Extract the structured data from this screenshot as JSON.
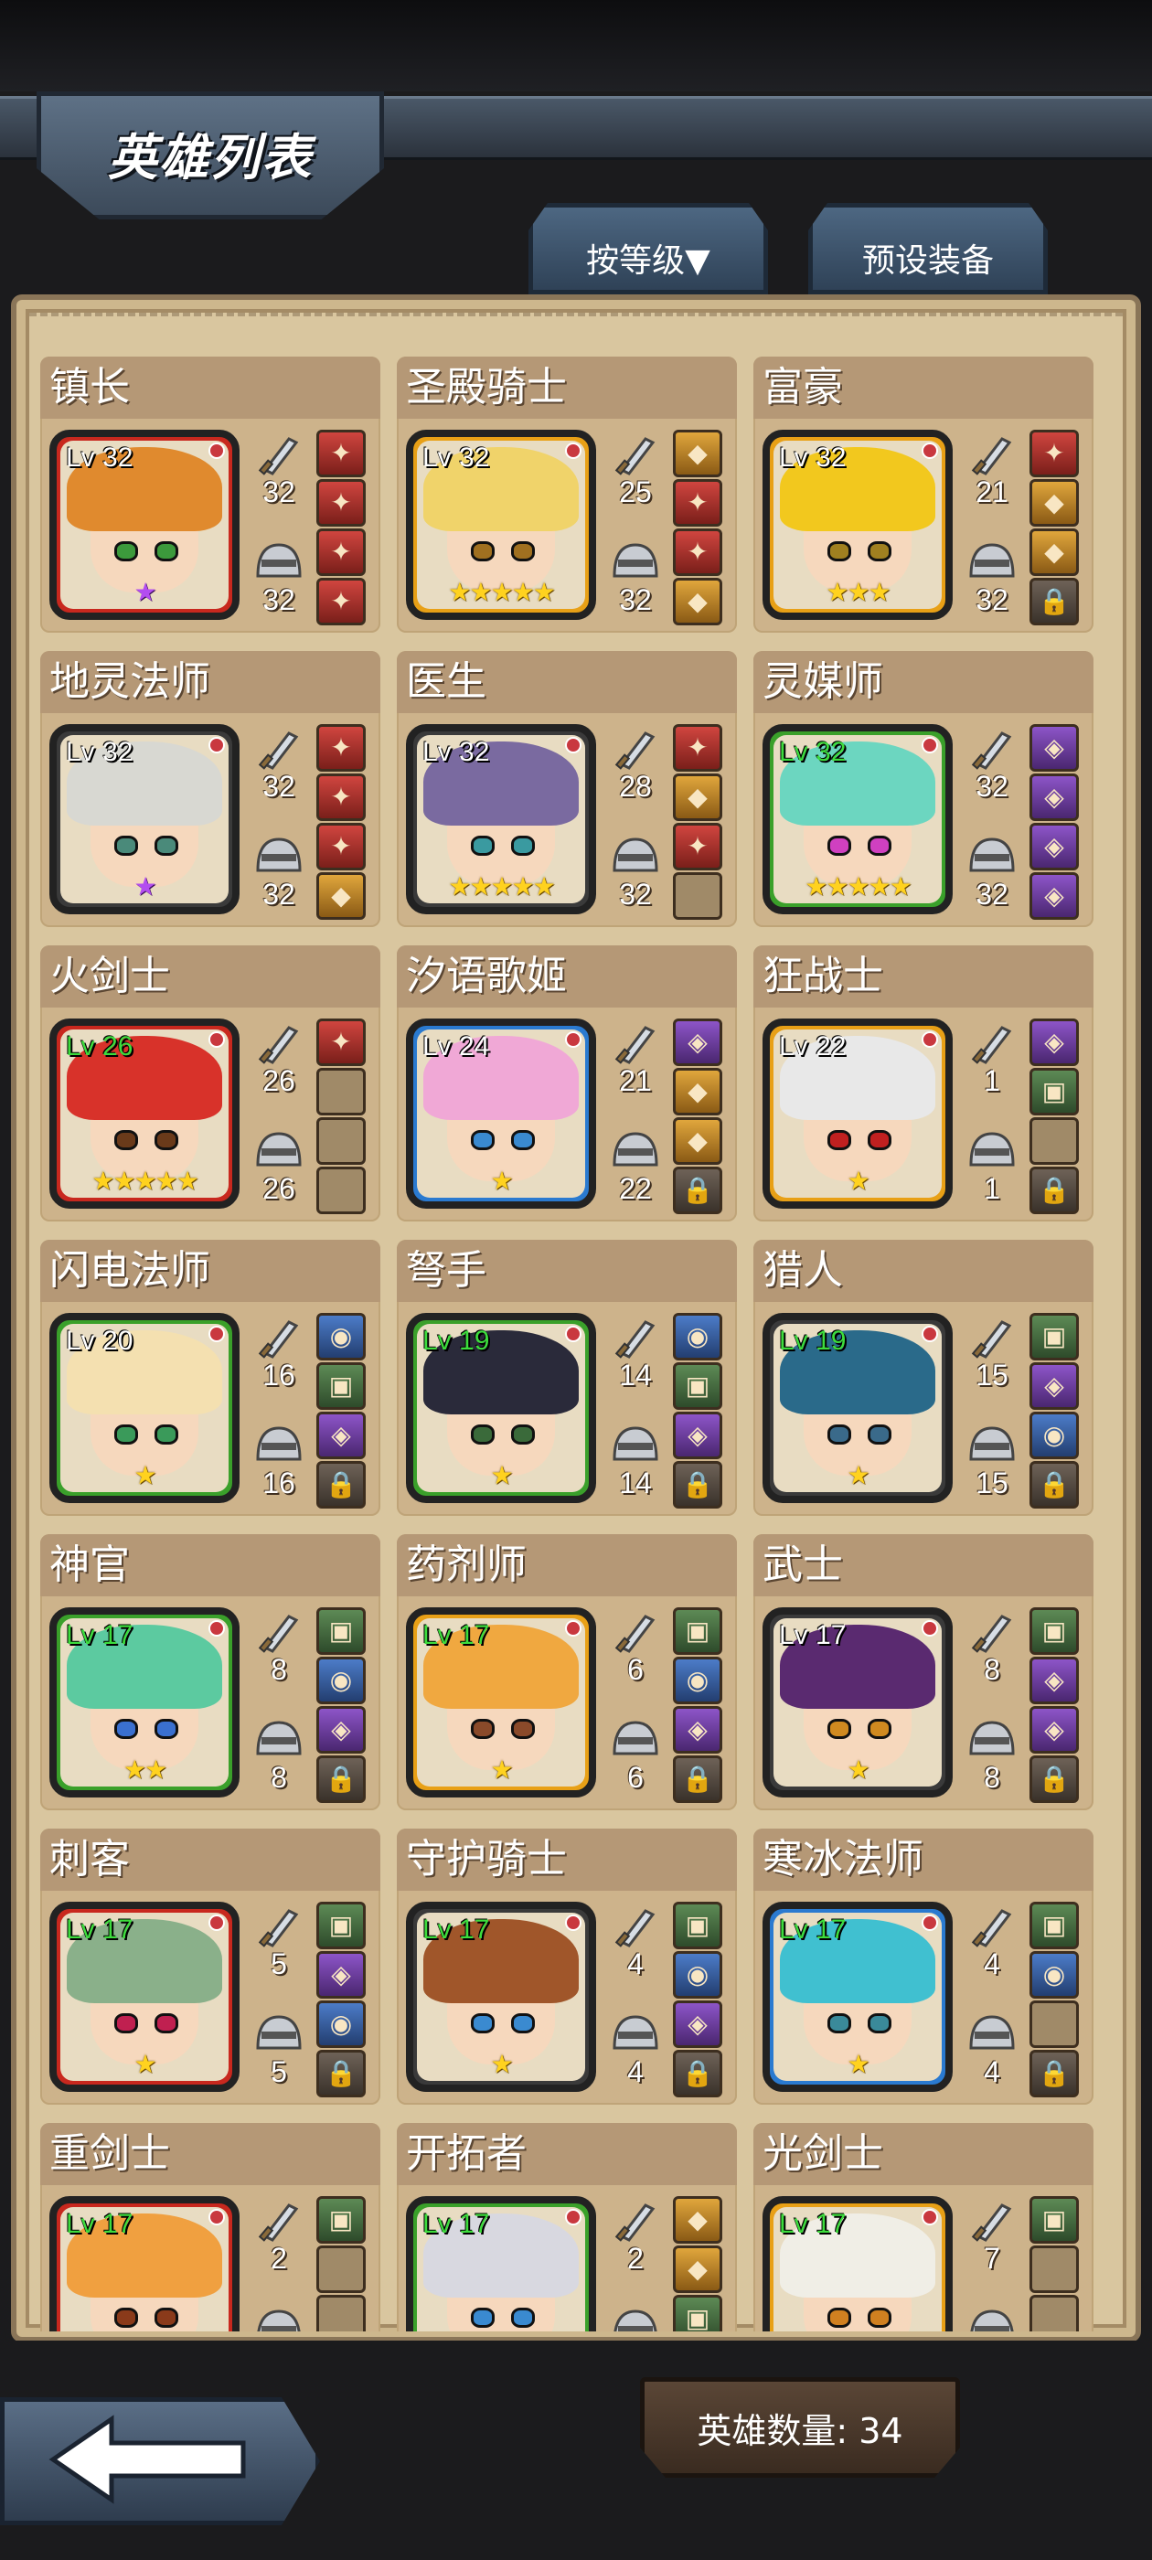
{
  "header": {
    "title": "英雄列表"
  },
  "tabs": {
    "sort_label": "按等级▼",
    "preset_label": "预设装备"
  },
  "footer": {
    "hero_count": "英雄数量: 34"
  },
  "heroes": [
    {
      "name": "镇长",
      "level": "Lv 32",
      "level_color": "#ffffff",
      "frame": "red",
      "hair": "#e08a2e",
      "eye": "#3c9a3c",
      "stars": "★",
      "star_color": "purple",
      "atk": "32",
      "def": "32",
      "slots": [
        "red",
        "red",
        "red",
        "red"
      ]
    },
    {
      "name": "圣殿骑士",
      "level": "Lv 32",
      "level_color": "#ffffff",
      "frame": "orange",
      "hair": "#f0d36a",
      "eye": "#a07020",
      "stars": "★★★★★",
      "star_color": "gold",
      "atk": "25",
      "def": "32",
      "slots": [
        "orange",
        "red",
        "red",
        "orange"
      ]
    },
    {
      "name": "富豪",
      "level": "Lv 32",
      "level_color": "#ffffff",
      "frame": "orange",
      "hair": "#f2c81e",
      "eye": "#a08020",
      "stars": "★★★",
      "star_color": "gold",
      "atk": "21",
      "def": "32",
      "slots": [
        "red",
        "orange",
        "orange",
        "lock"
      ]
    },
    {
      "name": "地灵法师",
      "level": "Lv 32",
      "level_color": "#ffffff",
      "frame": "dark",
      "hair": "#d8d8d2",
      "eye": "#4a8a7a",
      "stars": "★",
      "star_color": "purple",
      "atk": "32",
      "def": "32",
      "slots": [
        "red",
        "red",
        "red",
        "orange"
      ]
    },
    {
      "name": "医生",
      "level": "Lv 32",
      "level_color": "#ffffff",
      "frame": "dark",
      "hair": "#7a6aa0",
      "eye": "#3a9aa0",
      "stars": "★★★★★",
      "star_color": "gold",
      "atk": "28",
      "def": "32",
      "slots": [
        "red",
        "orange",
        "red",
        "empty"
      ]
    },
    {
      "name": "灵媒师",
      "level": "Lv 32",
      "level_color": "#3ddc3d",
      "frame": "green",
      "hair": "#6cd6c0",
      "eye": "#d040c0",
      "stars": "★★★★★",
      "star_color": "gold",
      "atk": "32",
      "def": "32",
      "slots": [
        "purple",
        "purple",
        "purple",
        "purple"
      ]
    },
    {
      "name": "火剑士",
      "level": "Lv 26",
      "level_color": "#3ddc3d",
      "frame": "red",
      "hair": "#d8322a",
      "eye": "#6a3a1a",
      "stars": "★★★★★",
      "star_color": "gold",
      "atk": "26",
      "def": "26",
      "slots": [
        "red",
        "empty",
        "empty",
        "empty"
      ]
    },
    {
      "name": "汐语歌姬",
      "level": "Lv 24",
      "level_color": "#ffffff",
      "frame": "blue",
      "hair": "#f0a8d6",
      "eye": "#3a8ad0",
      "stars": "★",
      "star_color": "gold",
      "atk": "21",
      "def": "22",
      "slots": [
        "purple",
        "orange",
        "orange",
        "lock"
      ]
    },
    {
      "name": "狂战士",
      "level": "Lv 22",
      "level_color": "#ffffff",
      "frame": "orange",
      "hair": "#e8e8e8",
      "eye": "#c02020",
      "stars": "★",
      "star_color": "gold",
      "atk": "1",
      "def": "1",
      "slots": [
        "purple",
        "green",
        "empty",
        "lock"
      ]
    },
    {
      "name": "闪电法师",
      "level": "Lv 20",
      "level_color": "#ffffff",
      "frame": "green",
      "hair": "#f4e0b0",
      "eye": "#3a9a5a",
      "stars": "★",
      "star_color": "gold",
      "atk": "16",
      "def": "16",
      "slots": [
        "blue",
        "green",
        "purple",
        "lock"
      ]
    },
    {
      "name": "弩手",
      "level": "Lv 19",
      "level_color": "#3ddc3d",
      "frame": "green",
      "hair": "#2a2a3a",
      "eye": "#3a6a3a",
      "stars": "★",
      "star_color": "gold",
      "atk": "14",
      "def": "14",
      "slots": [
        "blue",
        "green",
        "purple",
        "lock"
      ]
    },
    {
      "name": "猎人",
      "level": "Lv 19",
      "level_color": "#3ddc3d",
      "frame": "dark",
      "hair": "#2a6a8a",
      "eye": "#3a6a8a",
      "stars": "★",
      "star_color": "gold",
      "atk": "15",
      "def": "15",
      "slots": [
        "green",
        "purple",
        "blue",
        "lock"
      ]
    },
    {
      "name": "神官",
      "level": "Lv 17",
      "level_color": "#3ddc3d",
      "frame": "green",
      "hair": "#5ccaa0",
      "eye": "#3a70d0",
      "stars": "★★",
      "star_color": "gold",
      "atk": "8",
      "def": "8",
      "slots": [
        "green",
        "blue",
        "purple",
        "lock"
      ]
    },
    {
      "name": "药剂师",
      "level": "Lv 17",
      "level_color": "#3ddc3d",
      "frame": "orange",
      "hair": "#f0a840",
      "eye": "#8a4a2a",
      "stars": "★",
      "star_color": "gold",
      "atk": "6",
      "def": "6",
      "slots": [
        "green",
        "blue",
        "purple",
        "lock"
      ]
    },
    {
      "name": "武士",
      "level": "Lv 17",
      "level_color": "#ffffff",
      "frame": "dark",
      "hair": "#5a2a70",
      "eye": "#d08a20",
      "stars": "★",
      "star_color": "gold",
      "atk": "8",
      "def": "8",
      "slots": [
        "green",
        "purple",
        "purple",
        "lock"
      ]
    },
    {
      "name": "刺客",
      "level": "Lv 17",
      "level_color": "#3ddc3d",
      "frame": "red",
      "hair": "#8ab08a",
      "eye": "#c02050",
      "stars": "★",
      "star_color": "gold",
      "atk": "5",
      "def": "5",
      "slots": [
        "green",
        "purple",
        "blue",
        "lock"
      ]
    },
    {
      "name": "守护骑士",
      "level": "Lv 17",
      "level_color": "#3ddc3d",
      "frame": "dark",
      "hair": "#a0562a",
      "eye": "#3a8ad0",
      "stars": "★",
      "star_color": "gold",
      "atk": "4",
      "def": "4",
      "slots": [
        "green",
        "blue",
        "purple",
        "lock"
      ]
    },
    {
      "name": "寒冰法师",
      "level": "Lv 17",
      "level_color": "#3ddc3d",
      "frame": "blue",
      "hair": "#40c0d0",
      "eye": "#3a8a9a",
      "stars": "★",
      "star_color": "gold",
      "atk": "4",
      "def": "4",
      "slots": [
        "green",
        "blue",
        "empty",
        "lock"
      ]
    },
    {
      "name": "重剑士",
      "level": "Lv 17",
      "level_color": "#3ddc3d",
      "frame": "red",
      "hair": "#f0a040",
      "eye": "#8a3a1a",
      "stars": "",
      "star_color": "gold",
      "atk": "2",
      "def": "",
      "slots": [
        "green",
        "empty",
        "empty",
        "empty"
      ]
    },
    {
      "name": "开拓者",
      "level": "Lv 17",
      "level_color": "#3ddc3d",
      "frame": "green",
      "hair": "#d8d8e0",
      "eye": "#3a8ad0",
      "stars": "",
      "star_color": "gold",
      "atk": "2",
      "def": "",
      "slots": [
        "orange",
        "orange",
        "green",
        "empty"
      ]
    },
    {
      "name": "光剑士",
      "level": "Lv 17",
      "level_color": "#3ddc3d",
      "frame": "orange",
      "hair": "#f0eee6",
      "eye": "#d08020",
      "stars": "",
      "star_color": "gold",
      "atk": "7",
      "def": "",
      "slots": [
        "green",
        "empty",
        "empty",
        "empty"
      ]
    }
  ],
  "frame_colors": {
    "red": "#c8281e",
    "orange": "#e8a016",
    "green": "#3aa02a",
    "blue": "#2a7ad0",
    "dark": "#3a3a3a"
  },
  "icons": {
    "attack": "sword-icon",
    "defense": "helmet-icon",
    "locked_slot": "padlock-icon",
    "back": "arrow-left-icon"
  }
}
